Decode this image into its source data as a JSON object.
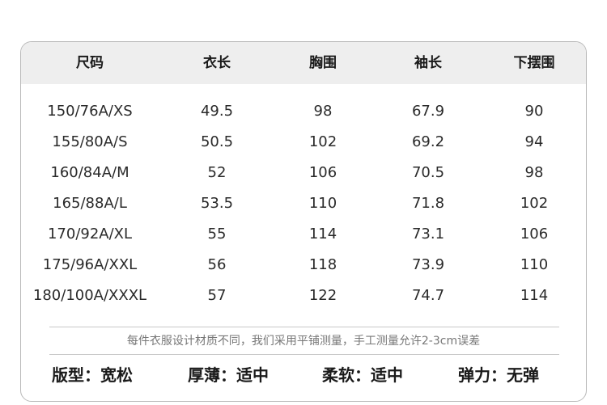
{
  "table": {
    "headers": [
      "尺码",
      "衣长",
      "胸围",
      "袖长",
      "下摆围"
    ],
    "rows": [
      [
        "150/76A/XS",
        "49.5",
        "98",
        "67.9",
        "90"
      ],
      [
        "155/80A/S",
        "50.5",
        "102",
        "69.2",
        "94"
      ],
      [
        "160/84A/M",
        "52",
        "106",
        "70.5",
        "98"
      ],
      [
        "165/88A/L",
        "53.5",
        "110",
        "71.8",
        "102"
      ],
      [
        "170/92A/XL",
        "55",
        "114",
        "73.1",
        "106"
      ],
      [
        "175/96A/XXL",
        "56",
        "118",
        "73.9",
        "110"
      ],
      [
        "180/100A/XXXL",
        "57",
        "122",
        "74.7",
        "114"
      ]
    ]
  },
  "note": "每件衣服设计材质不同，我们采用平铺测量，手工测量允许2-3cm误差",
  "attributes": [
    {
      "label": "版型：",
      "value": "宽松"
    },
    {
      "label": "厚薄：",
      "value": "适中"
    },
    {
      "label": "柔软：",
      "value": "适中"
    },
    {
      "label": "弹力：",
      "value": "无弹"
    }
  ]
}
